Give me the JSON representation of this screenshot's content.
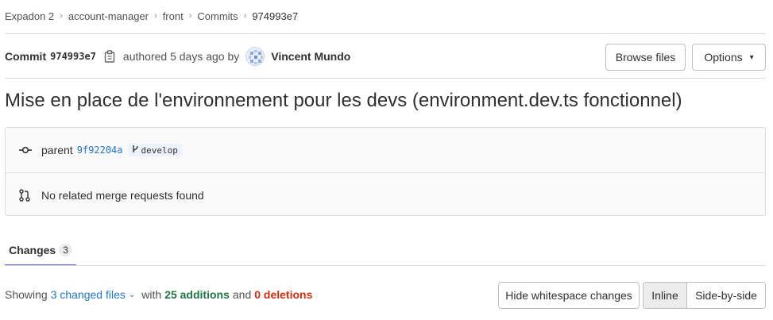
{
  "breadcrumb": [
    "Expadon 2",
    "account-manager",
    "front",
    "Commits",
    "974993e7"
  ],
  "commit": {
    "label": "Commit",
    "sha": "974993e7",
    "authored_text": "authored 5 days ago by",
    "author": "Vincent Mundo"
  },
  "buttons": {
    "browse_files": "Browse files",
    "options": "Options"
  },
  "title": "Mise en place de l'environnement pour les devs (environment.dev.ts fonctionnel)",
  "info": {
    "parent_label": "parent",
    "parent_sha": "9f92204a",
    "branch": "develop",
    "merge_requests": "No related merge requests found"
  },
  "tabs": [
    {
      "label": "Changes",
      "count": "3"
    }
  ],
  "diff_summary": {
    "showing": "Showing",
    "changed_files": "3 changed files",
    "with": "with",
    "additions": "25 additions",
    "and": "and",
    "deletions": "0 deletions"
  },
  "view_controls": {
    "hide_whitespace": "Hide whitespace changes",
    "inline": "Inline",
    "side_by_side": "Side-by-side"
  }
}
